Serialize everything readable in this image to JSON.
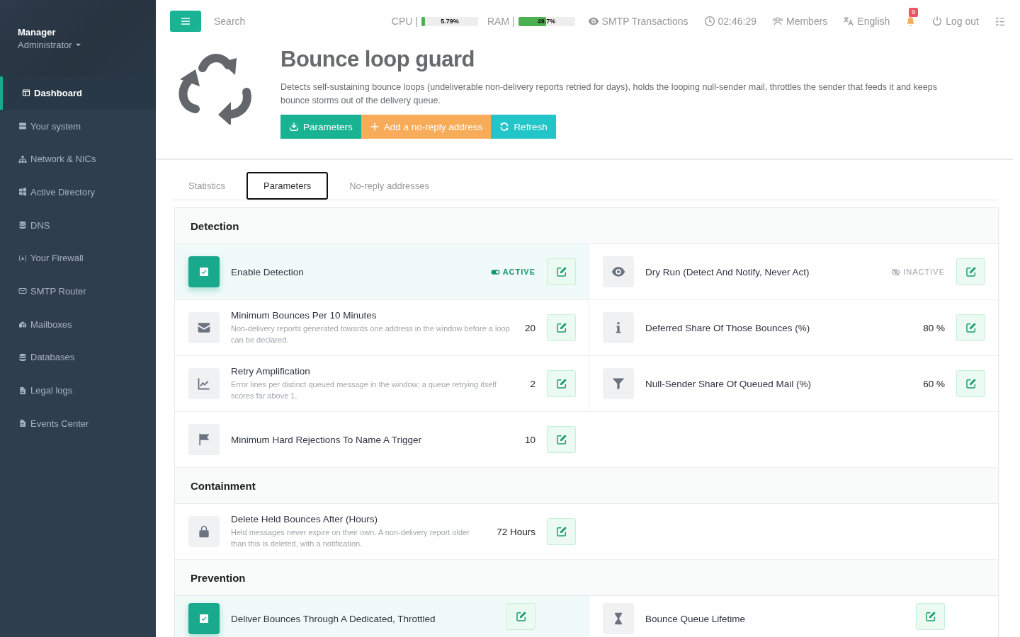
{
  "sidebar": {
    "user": {
      "name": "Manager",
      "role": "Administrator"
    },
    "items": [
      {
        "label": "Dashboard",
        "selected": true
      },
      {
        "label": "Your system",
        "selected": false
      },
      {
        "label": "Network & NICs",
        "selected": false
      },
      {
        "label": "Active Directory",
        "selected": false
      },
      {
        "label": "DNS",
        "selected": false
      },
      {
        "label": "Your Firewall",
        "selected": false
      },
      {
        "label": "SMTP Router",
        "selected": false
      },
      {
        "label": "Mailboxes",
        "selected": false
      },
      {
        "label": "Databases",
        "selected": false
      },
      {
        "label": "Legal logs",
        "selected": false
      },
      {
        "label": "Events Center",
        "selected": false
      }
    ]
  },
  "topbar": {
    "search": {
      "placeholder": "Search"
    },
    "meters": [
      {
        "label": "CPU |",
        "level": 0.0579,
        "reading": "5.79%"
      },
      {
        "label": "RAM |",
        "level": 0.497,
        "reading": "49.7%"
      }
    ],
    "links": [
      {
        "kind": "transactions",
        "label": "SMTP Transactions"
      },
      {
        "kind": "clock",
        "label": "02:46:29"
      },
      {
        "kind": "members",
        "label": "Members"
      },
      {
        "kind": "language",
        "label": "English"
      },
      {
        "kind": "notifications",
        "badge": "9"
      },
      {
        "kind": "logout",
        "label": "Log out"
      },
      {
        "kind": "tasks"
      }
    ]
  },
  "header": {
    "title": "Bounce loop guard",
    "description": "Detects self-sustaining bounce loops (undeliverable non-delivery reports retried for days), holds the looping null-sender mail, throttles the sender that feeds it and keeps bounce storms out of the delivery queue.",
    "buttons": [
      {
        "kind": "primary",
        "label": "Parameters"
      },
      {
        "kind": "warning",
        "label": "Add a no-reply address"
      },
      {
        "kind": "info",
        "label": "Refresh"
      }
    ]
  },
  "tabs": [
    {
      "label": "Statistics",
      "selected": false
    },
    {
      "label": "Parameters",
      "selected": true
    },
    {
      "label": "No-reply addresses",
      "selected": false
    }
  ],
  "sections": [
    {
      "title": "Detection",
      "rows": [
        {
          "cells": [
            {
              "kind": "toggle",
              "on": true,
              "title": "Enable Detection",
              "status": "ACTIVE"
            },
            {
              "kind": "toggle",
              "on": false,
              "title": "Dry Run (Detect And Notify, Never Act)",
              "status": "INACTIVE"
            }
          ]
        },
        {
          "cells": [
            {
              "kind": "value",
              "title": "Minimum Bounces Per 10 Minutes",
              "description": "Non-delivery reports generated towards one address in the window before a loop can be declared.",
              "value": "20"
            },
            {
              "kind": "value",
              "title": "Deferred Share Of Those Bounces (%)",
              "value": "80 %"
            }
          ]
        },
        {
          "cells": [
            {
              "kind": "value",
              "title": "Retry Amplification",
              "description": "Error lines per distinct queued message in the window; a queue retrying itself scores far above 1.",
              "value": "2"
            },
            {
              "kind": "value",
              "title": "Null-Sender Share Of Queued Mail (%)",
              "value": "60 %"
            }
          ]
        },
        {
          "cells": [
            {
              "kind": "value",
              "title": "Minimum Hard Rejections To Name A Trigger",
              "value": "10"
            }
          ]
        }
      ]
    },
    {
      "title": "Containment",
      "rows": [
        {
          "cells": [
            {
              "kind": "value",
              "title": "Delete Held Bounces After (Hours)",
              "description": "Held messages never expire on their own. A non-delivery report older than this is deleted, with a notification.",
              "value": "72 Hours"
            }
          ]
        }
      ]
    },
    {
      "title": "Prevention",
      "rows": [
        {
          "cells": [
            {
              "kind": "toggle",
              "on": true,
              "title": "Deliver Bounces Through A Dedicated, Throttled"
            },
            {
              "kind": "value",
              "title": "Bounce Queue Lifetime"
            }
          ]
        }
      ]
    }
  ]
}
